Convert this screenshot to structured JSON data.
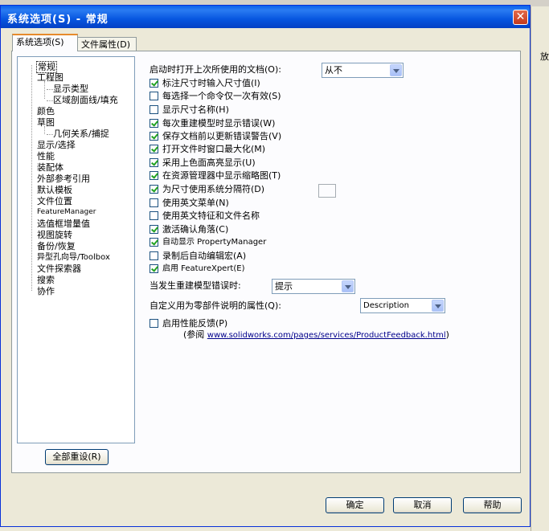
{
  "title": "系统选项(S) - 常规",
  "close_glyph": "✕",
  "bg_right_text": "放",
  "tabs": [
    {
      "label": "系统选项(S)"
    },
    {
      "label": "文件属性(D)"
    }
  ],
  "tree": [
    {
      "label": "常规"
    },
    {
      "label": "工程图"
    },
    {
      "label": "显示类型"
    },
    {
      "label": "区域剖面线/填充"
    },
    {
      "label": "颜色"
    },
    {
      "label": "草图"
    },
    {
      "label": "几何关系/捕捉"
    },
    {
      "label": "显示/选择"
    },
    {
      "label": "性能"
    },
    {
      "label": "装配体"
    },
    {
      "label": "外部参考引用"
    },
    {
      "label": "默认模板"
    },
    {
      "label": "文件位置"
    },
    {
      "label": "FeatureManager"
    },
    {
      "label": "选值框增量值"
    },
    {
      "label": "视图旋转"
    },
    {
      "label": "备份/恢复"
    },
    {
      "label": "异型孔向导/Toolbox"
    },
    {
      "label": "文件探索器"
    },
    {
      "label": "搜索"
    },
    {
      "label": "协作"
    }
  ],
  "reset_button": "全部重设(R)",
  "open_last_doc": {
    "label": "启动时打开上次所使用的文档(O):",
    "value": "从不"
  },
  "checkboxes": [
    {
      "label": "标注尺寸时输入尺寸值(I)",
      "checked": true
    },
    {
      "label": "每选择一个命令仅一次有效(S)",
      "checked": false
    },
    {
      "label": "显示尺寸名称(H)",
      "checked": false
    },
    {
      "label": "每次重建模型时显示错误(W)",
      "checked": true
    },
    {
      "label": "保存文档前以更新错误警告(V)",
      "checked": true
    },
    {
      "label": "打开文件时窗口最大化(M)",
      "checked": true
    },
    {
      "label": "采用上色面高亮显示(U)",
      "checked": true
    },
    {
      "label": "在资源管理器中显示缩略图(T)",
      "checked": true
    },
    {
      "label": "为尺寸使用系统分隔符(D)",
      "checked": true
    },
    {
      "label": "使用英文菜单(N)",
      "checked": false
    },
    {
      "label": "使用英文特征和文件名称",
      "checked": false
    },
    {
      "label": "激活确认角落(C)",
      "checked": true
    },
    {
      "label": "自动显示 PropertyManager",
      "checked": true
    },
    {
      "label": "录制后自动编辑宏(A)",
      "checked": false
    },
    {
      "label": "启用 FeatureXpert(E)",
      "checked": true
    }
  ],
  "rebuild_error": {
    "label": "当发生重建模型错误时:",
    "value": "提示"
  },
  "part_desc": {
    "label": "自定义用为零部件说明的属性(Q):",
    "value": "Description"
  },
  "perf_feedback": {
    "label": "启用性能反馈(P)",
    "checked": false
  },
  "see_prefix": "(参阅",
  "feedback_link": "www.solidworks.com/pages/services/ProductFeedback.html",
  "see_suffix": ")",
  "buttons": {
    "ok": "确定",
    "cancel": "取消",
    "help": "帮助"
  }
}
